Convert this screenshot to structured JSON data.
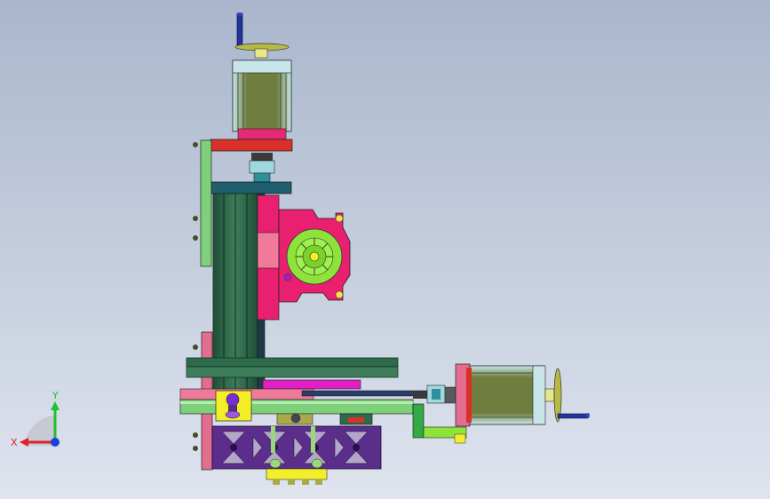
{
  "viewport": {
    "background_top": "#a9b6cc",
    "background_bottom": "#dfe4ee"
  },
  "triad": {
    "x_label": "X",
    "y_label": "Y",
    "x_color": "#e0202a",
    "y_color": "#1fbf2e",
    "z_color": "#1f3fdb"
  },
  "colors": {
    "motor_body": "#6f7d3e",
    "motor_fin": "#c8e6ea",
    "plate_red": "#d9302a",
    "plate_teal": "#1f5f6e",
    "plate_green": "#7ed07a",
    "rail_green": "#2e6b4c",
    "magenta": "#e8206f",
    "pink": "#ef7a9a",
    "lime": "#8ee33a",
    "purple": "#5b2e8c",
    "yellow": "#f2ee2a",
    "olive": "#a9a84a",
    "navy": "#1e3a8a"
  }
}
